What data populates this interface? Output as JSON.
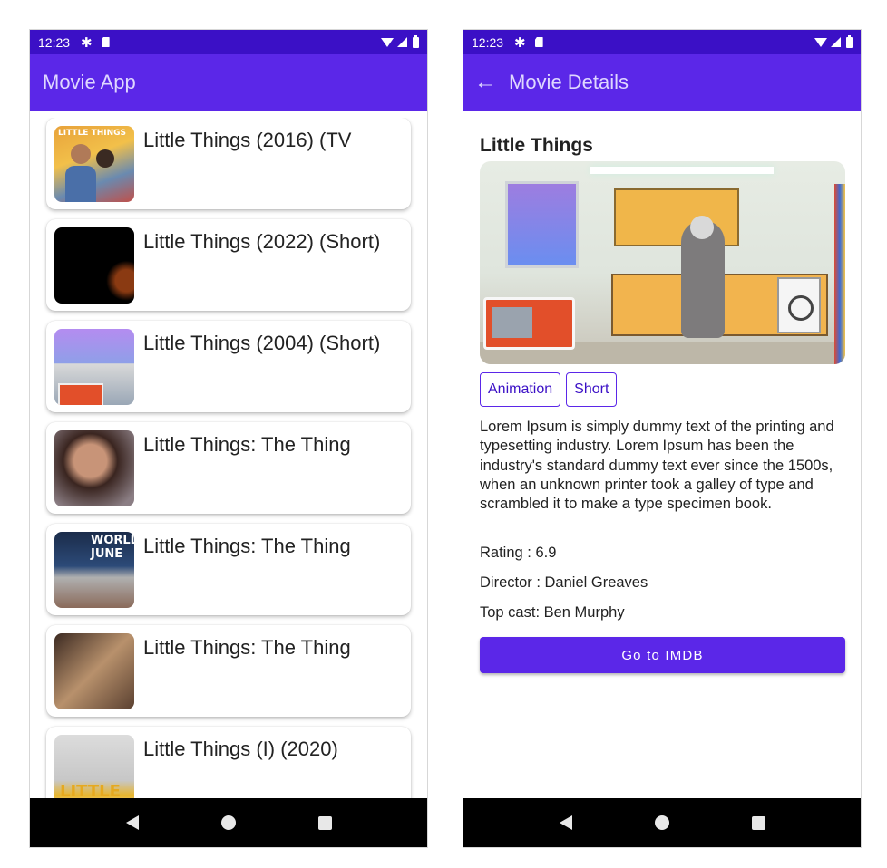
{
  "left_screen": {
    "status": {
      "time": "12:23"
    },
    "app_bar": {
      "title": "Movie App"
    },
    "movies": [
      {
        "title": "Little Things (2016) (TV",
        "thumb_text": "LITTLE THINGS"
      },
      {
        "title": "Little Things (2022) (Short)",
        "thumb_text": ""
      },
      {
        "title": "Little Things (2004) (Short)",
        "thumb_text": ""
      },
      {
        "title": "Little Things: The Thing",
        "thumb_text": ""
      },
      {
        "title": "Little Things: The Thing",
        "thumb_text": "WORLD JUNE"
      },
      {
        "title": "Little Things: The Thing",
        "thumb_text": ""
      },
      {
        "title": "Little Things (I) (2020)",
        "thumb_text": "LITTLE"
      }
    ]
  },
  "right_screen": {
    "status": {
      "time": "12:23"
    },
    "app_bar": {
      "title": "Movie Details"
    },
    "movie": {
      "title": "Little Things",
      "genres": [
        "Animation",
        "Short"
      ],
      "description": "Lorem Ipsum is simply dummy text of the printing and typesetting industry. Lorem Ipsum has been the industry's standard dummy text ever since the 1500s, when an unknown printer took a galley of type and scrambled it to make a type specimen book.",
      "rating": "Rating : 6.9",
      "director": "Director : Daniel Greaves",
      "top_cast": "Top cast: Ben Murphy"
    },
    "imdb_button": "Go to IMDB"
  },
  "colors": {
    "status_bar": "#3b10c6",
    "app_bar": "#5b27e8",
    "accent": "#5b27e8"
  }
}
